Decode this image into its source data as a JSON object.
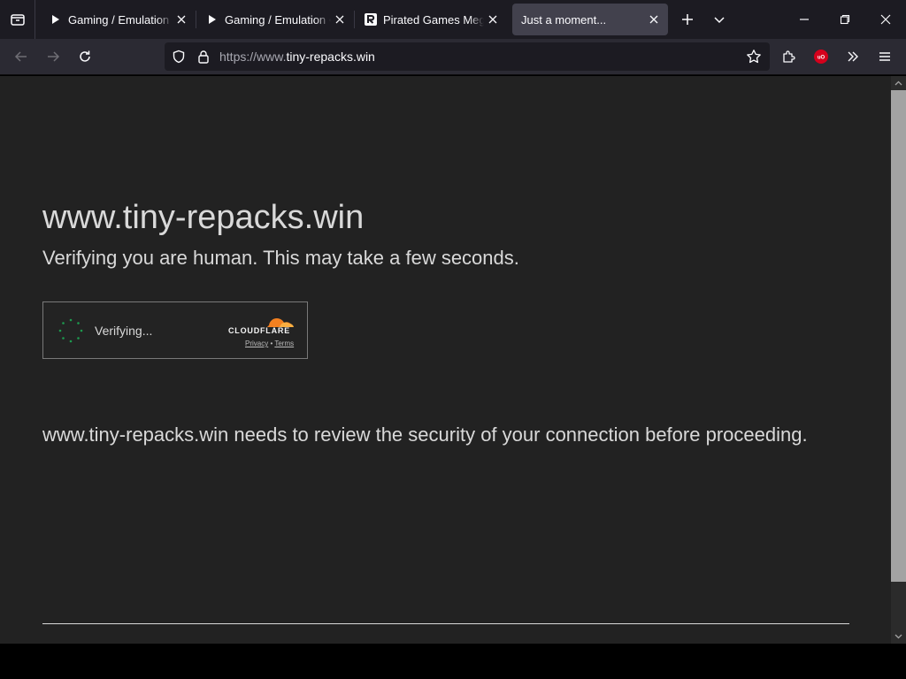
{
  "tabs": [
    {
      "title": "Gaming / Emulation • FMHY",
      "icon": "play-icon",
      "active": false
    },
    {
      "title": "Gaming / Emulation • FMHY",
      "icon": "play-icon",
      "active": false
    },
    {
      "title": "Pirated Games Mega Thread",
      "icon": "r-logo-icon",
      "active": false
    },
    {
      "title": "Just a moment...",
      "icon": "none",
      "active": true
    }
  ],
  "urlbar": {
    "scheme": "https://www.",
    "host": "tiny-repacks.win"
  },
  "page": {
    "title": "www.tiny-repacks.win",
    "subtitle": "Verifying you are human. This may take a few seconds.",
    "security_message": "www.tiny-repacks.win needs to review the security of your connection before proceeding."
  },
  "cloudflare": {
    "status": "Verifying...",
    "brand": "CLOUDFLARE",
    "privacy": "Privacy",
    "separator": "•",
    "terms": "Terms"
  },
  "colors": {
    "accent_orange": "#f38020",
    "spinner_green": "#1d9b4f",
    "extension_red": "#d5001c"
  }
}
